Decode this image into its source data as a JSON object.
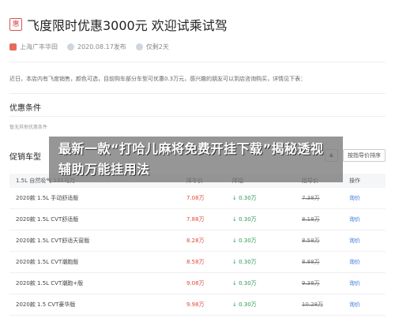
{
  "header": {
    "title_badge": "惠",
    "title": "飞度限时优惠3000元 欢迎试乘试驾",
    "dealer": "上海广丰华田",
    "date": "2020.08.17发布",
    "days_left": "仅剩2天"
  },
  "body_text": "近日，本店内有飞度销售，颜色可选，目前购车部分车型可优惠0.3万元，感兴趣的朋友可以到店咨询购买，详情见下表：",
  "conditions": {
    "title": "优惠条件",
    "note": "暂无其他优惠条件"
  },
  "promo": {
    "title": "促销车型",
    "buttons": [
      "▲",
      "按指导价排序"
    ]
  },
  "table": {
    "headers": [
      "1.5L 自然吸气 131马力",
      "降车价",
      "降幅",
      "指导价",
      "操作"
    ],
    "rows": [
      {
        "name": "2020款 1.5L 手动舒适版",
        "price": "7.08万",
        "drop": "↓ 0.30万",
        "msrp": "7.38万",
        "op": "询价"
      },
      {
        "name": "2020款 1.5L CVT舒适版",
        "price": "7.88万",
        "drop": "↓ 0.30万",
        "msrp": "8.18万",
        "op": "询价"
      },
      {
        "name": "2020款 1.5L CVT舒适天窗版",
        "price": "8.28万",
        "drop": "↓ 0.30万",
        "msrp": "8.58万",
        "op": "询价"
      },
      {
        "name": "2020款 1.5L CVT潮跑版",
        "price": "8.58万",
        "drop": "↓ 0.30万",
        "msrp": "8.88万",
        "op": "询价"
      },
      {
        "name": "2020款 1.5L CVT潮跑+版",
        "price": "9.08万",
        "drop": "↓ 0.30万",
        "msrp": "9.38万",
        "op": "询价"
      },
      {
        "name": "2020款 1.5 CVT豪华版",
        "price": "9.98万",
        "drop": "↓ 0.30万",
        "msrp": "10.28万",
        "op": "询价"
      }
    ]
  },
  "overlay": {
    "text": "最新一款“打哈儿麻将免费开挂下载”揭秘透视辅助万能挂用法"
  }
}
